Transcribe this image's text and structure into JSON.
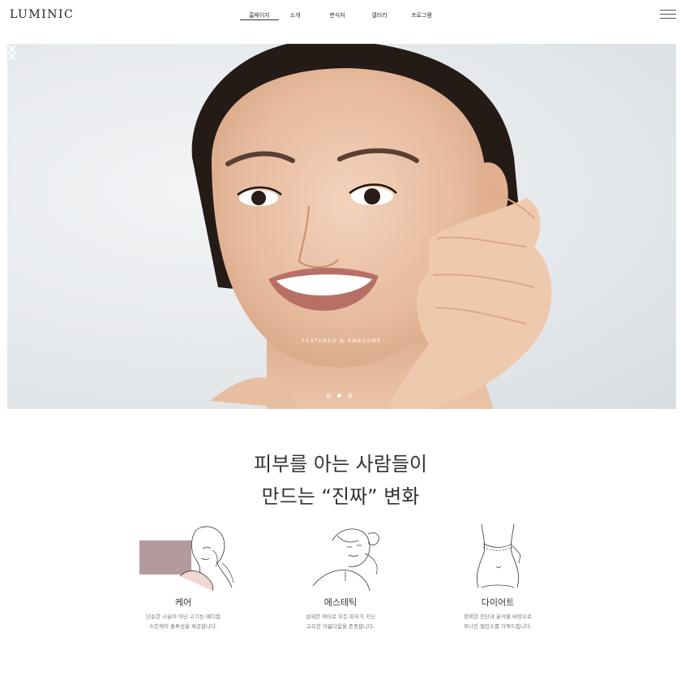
{
  "header": {
    "logo": "LUMINIC",
    "nav": [
      {
        "label": "홈페이지",
        "active": true
      },
      {
        "label": "소개",
        "active": false
      },
      {
        "label": "변식처",
        "active": false
      },
      {
        "label": "갤러리",
        "active": false
      },
      {
        "label": "프로그램",
        "active": false
      }
    ],
    "menu_icon": "hamburger-icon"
  },
  "hero": {
    "caption": "FEATURED & AWESOME",
    "slides": 3,
    "active_slide": 2,
    "prev_icon": "chevron-left-icon",
    "next_icon": "chevron-right-icon"
  },
  "headline": {
    "line1": "피부를 아는 사람들이",
    "line2": "만드는 “진짜” 변화"
  },
  "services": [
    {
      "title": "케어",
      "desc1": "단순한 시술이 아닌 고기능 메디컬",
      "desc2": "스킨케어 솔루션을 제공합니다.",
      "icon": "face-care-illustration"
    },
    {
      "title": "에스테틱",
      "desc1": "섬세한 케어로 모든 피부가 지닌",
      "desc2": "고유한 아름다움을 존중합니다.",
      "icon": "facial-treatment-illustration"
    },
    {
      "title": "다이어트",
      "desc1": "정확한 진단과 분석을 바탕으로",
      "desc2": "무너진 밸런스를 가꿔드립니다.",
      "icon": "waist-measure-illustration"
    }
  ],
  "colors": {
    "swatch": "#b39a9e",
    "text": "#333333",
    "muted": "#777777"
  }
}
